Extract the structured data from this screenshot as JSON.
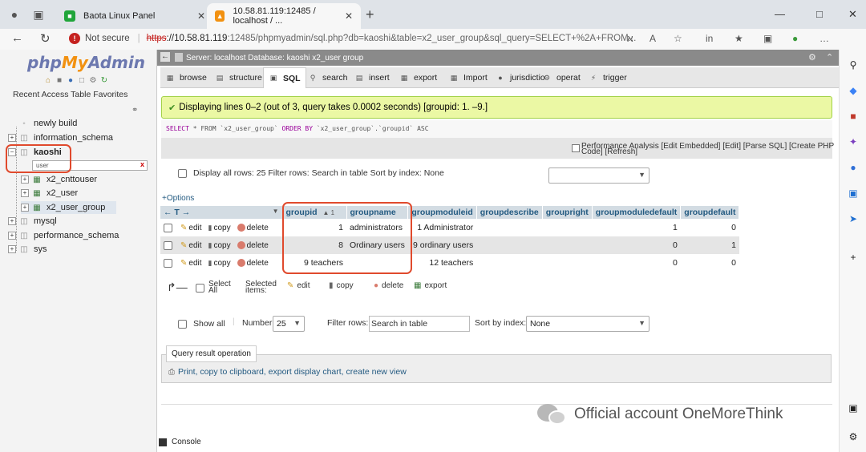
{
  "browser": {
    "tabs": [
      {
        "label": "Baota Linux Panel",
        "active": false
      },
      {
        "label": "10.58.81.119:12485 / localhost / ...",
        "active": true
      }
    ],
    "security_label": "Not secure",
    "url_scheme": "https",
    "url_host": "://10.58.81.119",
    "url_rest": ":12485/phpmyadmin/sql.php?db=kaoshi&table=x2_user_group&sql_query=SELECT+%2A+FROM...",
    "profile_label": "in"
  },
  "pma_nav": {
    "recent_label": "Recent Access Table Favorites",
    "filter_placeholder": "user",
    "tree": [
      {
        "label": "newly build"
      },
      {
        "label": "information_schema"
      },
      {
        "label": "kaoshi"
      },
      {
        "label": "x2_cnttouser"
      },
      {
        "label": "x2_user"
      },
      {
        "label": "x2_user_group"
      },
      {
        "label": "mysql"
      },
      {
        "label": "performance_schema"
      },
      {
        "label": "sys"
      }
    ]
  },
  "server_bar": {
    "text": "Server: localhost Database: kaoshi x2_user group"
  },
  "tabs": {
    "browse": "browse",
    "structure": "structure",
    "sql": "SQL",
    "search": "search",
    "insert": "insert",
    "export": "export",
    "import": "Import",
    "jurisdiction": "jurisdictio",
    "operation": "operat",
    "trigger": "trigger"
  },
  "result": {
    "message": "Displaying lines 0–2 (out of 3, query takes 0.0002 seconds) [groupid: 1. –9.]",
    "sql_select": "SELECT",
    "sql_mid": " * FROM `x2_user_group` ",
    "sql_order": "ORDER BY",
    "sql_end": " `x2_user_group`.`groupid` ASC",
    "perf_links": "Performance Analysis [Edit Embedded] [Edit] [Parse SQL] [Create PHP",
    "perf_links2": "Code] [Refresh]"
  },
  "nav_controls": {
    "display_all": "Display all rows: 25 Filter rows: Search in table Sort by index: None"
  },
  "options_label": "+Options",
  "t_arrows": "← T →",
  "table": {
    "headers": [
      "groupid",
      "groupname",
      "groupmoduleid",
      "groupdescribe",
      "groupright",
      "groupmoduledefault",
      "groupdefault"
    ],
    "sort_indicator": "▲ 1",
    "action_labels": {
      "edit": "edit",
      "copy": "copy",
      "delete": "delete"
    },
    "rows": [
      {
        "groupid": "1",
        "groupname": "administrators",
        "groupmoduleid": "1 Administrator",
        "groupdescribe": "",
        "groupright": "",
        "groupmoduledefault": "1",
        "groupdefault": "0"
      },
      {
        "groupid": "8",
        "groupname": "Ordinary users",
        "groupmoduleid": "9 ordinary users",
        "groupdescribe": "",
        "groupright": "",
        "groupmoduledefault": "0",
        "groupdefault": "1"
      },
      {
        "groupid": "9 teachers",
        "groupname": "",
        "groupmoduleid": "12 teachers",
        "groupdescribe": "",
        "groupright": "",
        "groupmoduledefault": "0",
        "groupdefault": "0"
      }
    ]
  },
  "bulk": {
    "select_all": "Select",
    "select_all2": "All",
    "selected": "Selected",
    "selected2": "items:",
    "edit": "edit",
    "copy": "copy",
    "delete": "delete",
    "export": "export"
  },
  "bottom_nav": {
    "show_all": "Show all",
    "number": "Number",
    "number_value": "25",
    "filter_label": "Filter rows:",
    "filter_placeholder": "Search in table",
    "sort_label": "Sort by index:",
    "sort_value": "None"
  },
  "query_ops": {
    "legend": "Query result operation",
    "link": "Print, copy to clipboard, export display chart, create new view"
  },
  "watermark": "Official account OneMoreThink",
  "console": "Console"
}
